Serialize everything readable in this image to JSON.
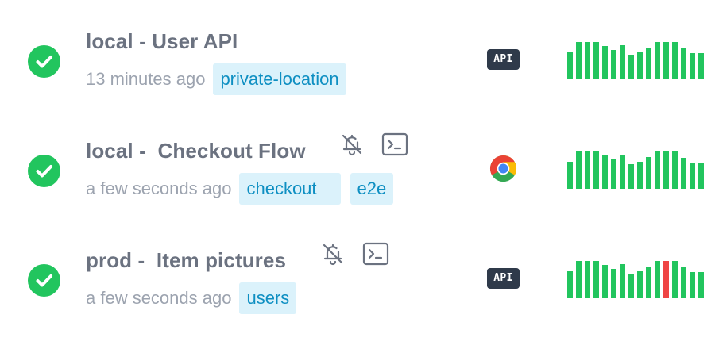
{
  "colors": {
    "success": "#22c55e",
    "failure": "#ef4444",
    "title": "#6b7280",
    "time": "#9ca3af",
    "tag_bg": "#dbf2fb",
    "tag_text": "#0e8fc2",
    "badge_bg": "#2f3a4a"
  },
  "checks": [
    {
      "status": "passing",
      "status_icon": "check-circle-icon",
      "title": "local - User API",
      "muted": false,
      "has_setup_script": false,
      "time": "13 minutes ago",
      "tags": [
        "private-location"
      ],
      "type": "api",
      "type_label": "API",
      "results": [
        "pass",
        "pass",
        "pass",
        "pass",
        "pass",
        "pass",
        "pass",
        "pass",
        "pass",
        "pass",
        "pass",
        "pass",
        "pass",
        "pass",
        "pass",
        "pass"
      ]
    },
    {
      "status": "passing",
      "status_icon": "check-circle-icon",
      "title": "local -  Checkout Flow",
      "muted": true,
      "muted_icon": "bell-off-icon",
      "has_setup_script": true,
      "script_icon": "terminal-icon",
      "time": "a few seconds ago",
      "tags": [
        "checkout",
        "e2e"
      ],
      "type": "browser",
      "type_icon": "chrome-icon",
      "results": [
        "pass",
        "pass",
        "pass",
        "pass",
        "pass",
        "pass",
        "pass",
        "pass",
        "pass",
        "pass",
        "pass",
        "pass",
        "pass",
        "pass",
        "pass",
        "pass"
      ]
    },
    {
      "status": "passing",
      "status_icon": "check-circle-icon",
      "title": "prod -  Item pictures",
      "muted": true,
      "muted_icon": "bell-off-icon",
      "has_setup_script": true,
      "script_icon": "terminal-icon",
      "time": "a few seconds ago",
      "tags": [
        "users"
      ],
      "type": "api",
      "type_label": "API",
      "results": [
        "pass",
        "pass",
        "pass",
        "pass",
        "pass",
        "pass",
        "pass",
        "pass",
        "pass",
        "pass",
        "pass",
        "fail",
        "pass",
        "pass",
        "pass",
        "pass"
      ]
    }
  ]
}
